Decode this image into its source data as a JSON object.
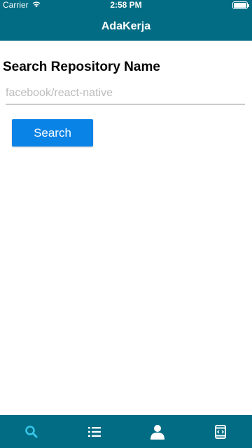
{
  "status_bar": {
    "carrier": "Carrier",
    "time": "2:58 PM"
  },
  "header": {
    "title": "AdaKerja"
  },
  "main": {
    "section_title": "Search Repository Name",
    "search_placeholder": "facebook/react-native",
    "search_value": "",
    "search_button_label": "Search"
  },
  "tab_bar": {
    "items": [
      {
        "icon": "search-icon",
        "active": true
      },
      {
        "icon": "list-icon",
        "active": false
      },
      {
        "icon": "user-icon",
        "active": false
      },
      {
        "icon": "code-device-icon",
        "active": false
      }
    ]
  },
  "colors": {
    "header_bg": "#016c83",
    "button_bg": "#0a83e6",
    "tab_active": "#35c6e8",
    "tab_inactive": "#ffffff"
  }
}
